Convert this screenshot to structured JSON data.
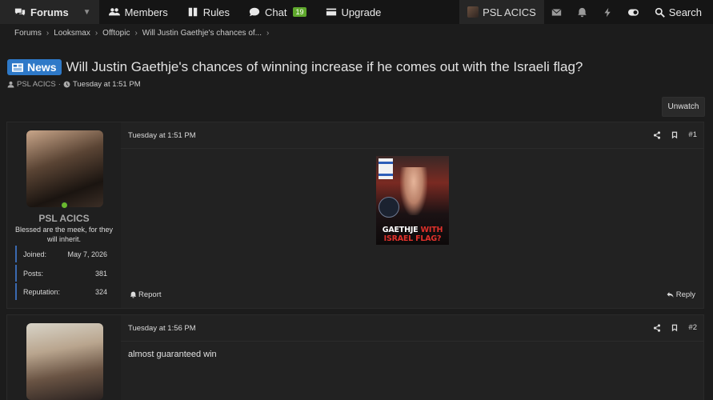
{
  "nav": {
    "forums": "Forums",
    "members": "Members",
    "rules": "Rules",
    "chat": "Chat",
    "chat_count": "19",
    "upgrade": "Upgrade",
    "user": "PSL ACICS",
    "search": "Search"
  },
  "breadcrumb": [
    "Forums",
    "Looksmax",
    "Offtopic",
    "Will Justin Gaethje's chances of..."
  ],
  "thread": {
    "prefix": "News",
    "title": "Will Justin Gaethje's chances of winning increase if he comes out with the Israeli flag?",
    "author": "PSL ACICS",
    "meta_sep": "·",
    "date": "Tuesday at 1:51 PM",
    "unwatch": "Unwatch"
  },
  "posts": [
    {
      "username": "PSL ACICS",
      "usertitle": "Blessed are the meek, for they will inherit.",
      "stats": [
        {
          "label": "Joined:",
          "value": "May 7, 2026"
        },
        {
          "label": "Posts:",
          "value": "381"
        },
        {
          "label": "Reputation:",
          "value": "324"
        }
      ],
      "date": "Tuesday at 1:51 PM",
      "number": "#1",
      "image_caption_white": "GAETHJE",
      "image_caption_red1": "WITH",
      "image_caption_red2": "ISRAEL FLAG?",
      "report": "Report",
      "reply": "Reply"
    },
    {
      "date": "Tuesday at 1:56 PM",
      "number": "#2",
      "text": "almost guaranteed win"
    }
  ],
  "colors": {
    "accent": "#2e79c8",
    "online": "#69b82f",
    "chat_badge": "#5fa82c",
    "caption_red": "#e0312b"
  },
  "icons": [
    "comments-icon",
    "users-icon",
    "book-icon",
    "chat-icon",
    "card-icon",
    "envelope-icon",
    "bell-icon",
    "bolt-icon",
    "toggle-icon",
    "search-icon",
    "share-icon",
    "bookmark-icon",
    "user-icon",
    "clock-icon",
    "report-icon",
    "reply-icon"
  ]
}
